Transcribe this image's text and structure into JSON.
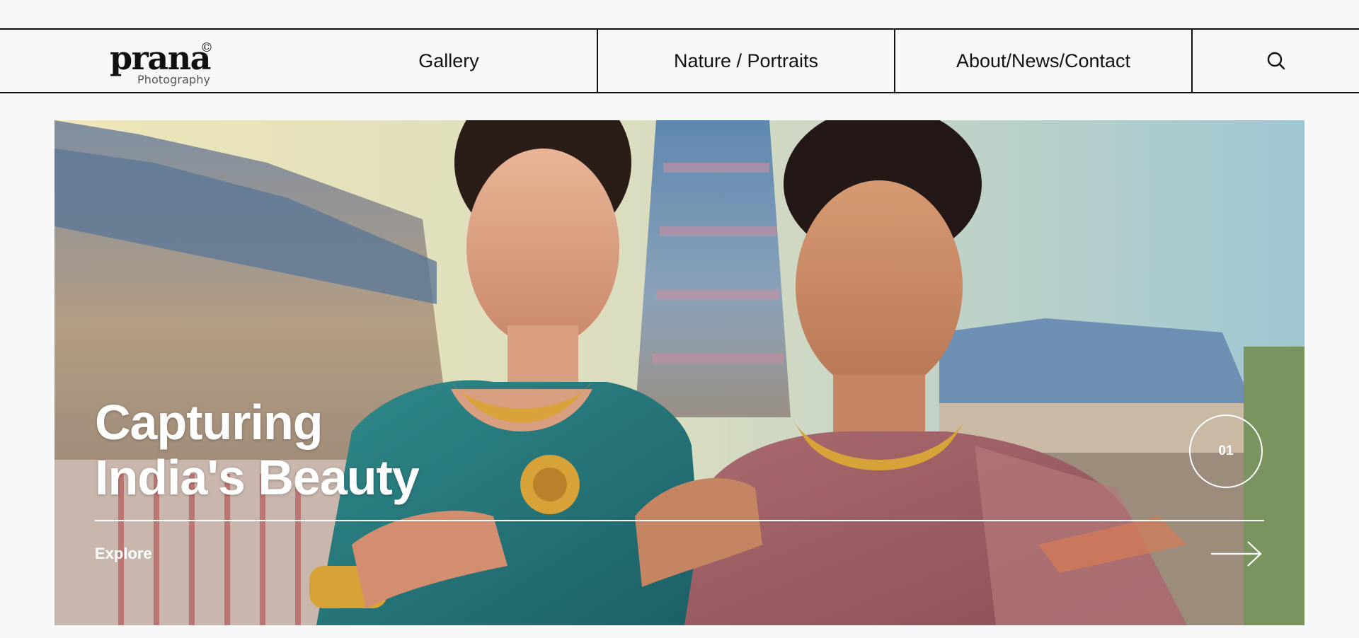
{
  "brand": {
    "name": "prana",
    "mark": "©",
    "tagline": "Photography"
  },
  "nav": {
    "items": [
      {
        "label": "Gallery"
      },
      {
        "label": "Nature / Portraits"
      },
      {
        "label": "About/News/Contact"
      }
    ],
    "search_icon": "search-icon"
  },
  "hero": {
    "title_line1": "Capturing",
    "title_line2": "India's Beauty",
    "slide_number": "01",
    "cta_label": "Explore",
    "arrow_icon": "arrow-right-icon"
  },
  "colors": {
    "background": "#f8f8f8",
    "border": "#111111",
    "hero_text": "#ffffff"
  }
}
